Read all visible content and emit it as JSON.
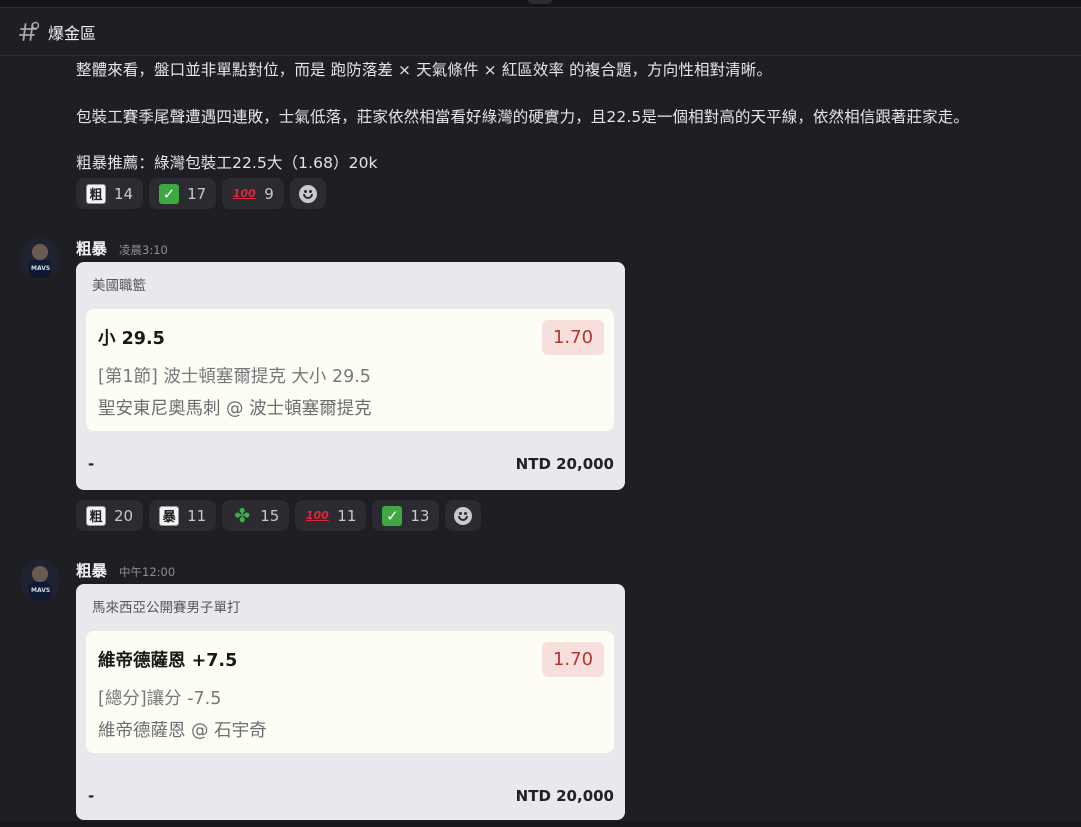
{
  "channel": {
    "name": "爆金區"
  },
  "first_message": {
    "line1": "整體來看，盤口並非單點對位，而是 跑防落差 × 天氣條件 × 紅區效率 的複合題，方向性相對清晰。",
    "line2": "包裝工賽季尾聲遭遇四連敗，士氣低落，莊家依然相當看好綠灣的硬實力，且22.5是一個相對高的天平線，依然相信跟著莊家走。",
    "line3": "粗暴推薦：綠灣包裝工22.5大（1.68）20k",
    "reactions": [
      {
        "emoji": "粗",
        "count": "14"
      },
      {
        "emoji": "✓",
        "count": "17"
      },
      {
        "emoji": "100",
        "count": "9"
      }
    ]
  },
  "posts": [
    {
      "author": "粗暴",
      "time": "凌晨3:10",
      "avatar_text": "MAVS",
      "card": {
        "league": "美國職籃",
        "pick": "小 29.5",
        "odds": "1.70",
        "market": "[第1節] 波士頓塞爾提克 大小 29.5",
        "match": "聖安東尼奧馬刺 @ 波士頓塞爾提克",
        "dash": "-",
        "stake": "NTD 20,000"
      },
      "reactions": [
        {
          "emoji": "粗",
          "count": "20"
        },
        {
          "emoji": "暴",
          "count": "11"
        },
        {
          "emoji": "✤",
          "count": "15"
        },
        {
          "emoji": "100",
          "count": "11"
        },
        {
          "emoji": "✓",
          "count": "13"
        }
      ]
    },
    {
      "author": "粗暴",
      "time": "中午12:00",
      "avatar_text": "MAVS",
      "card": {
        "league": "馬來西亞公開賽男子單打",
        "pick": "維帝德薩恩 +7.5",
        "odds": "1.70",
        "market": "[總分]讓分 -7.5",
        "match": "維帝德薩恩 @ 石宇奇",
        "dash": "-",
        "stake": "NTD 20,000"
      }
    }
  ]
}
